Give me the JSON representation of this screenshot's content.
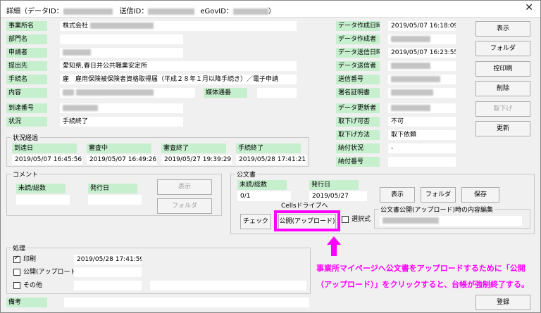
{
  "window": {
    "title_prefix": "詳細（データID：",
    "title_send": "　送信ID：",
    "title_egov": "eGovID：",
    "title_suffix": "）",
    "close_glyph": "✕"
  },
  "labels": {
    "office": "事業所名",
    "dept": "部門名",
    "applicant": "申請者",
    "destination": "提出先",
    "procedure": "手続名",
    "content": "内容",
    "medium": "媒体通番",
    "arrival_no": "到達番号",
    "status": "状況",
    "created_at": "データ作成日時",
    "creator": "データ作成者",
    "sent_at": "データ送信日時",
    "sender": "データ送信者",
    "send_no": "送信番号",
    "signer_cert": "署名証明書",
    "updater": "データ更新者",
    "withdraw_ok": "取下げ可否",
    "withdraw_method": "取下げ方法",
    "payment_status": "納付状況",
    "payment_no": "納付番号"
  },
  "values": {
    "office": "株式会社",
    "destination": "愛知県,春日井公共職業安定所",
    "procedure": "雇　雇用保険被保険者資格取得届（平成２８年１月以降手続き）／電子申請",
    "status": "手続終了",
    "created_at": "2019/05/07 16:18:09",
    "sent_at": "2019/05/07 16:23:55",
    "withdraw_ok": "不可",
    "withdraw_method": "取下依頼",
    "payment_status": "-"
  },
  "progress": {
    "title": "状況経過",
    "steps": [
      {
        "label": "到達日",
        "value": "2019/05/07 16:45:56"
      },
      {
        "label": "審査中",
        "value": "2019/05/07 16:49:26"
      },
      {
        "label": "審査終了",
        "value": "2019/05/27 19:39:29"
      },
      {
        "label": "手続終了",
        "value": "2019/05/28 17:41:21"
      }
    ]
  },
  "comment": {
    "title": "コメント",
    "unread_label": "未読/総数",
    "issue_label": "発行日",
    "show_button": "表示",
    "folder_button": "フォルダ"
  },
  "docs": {
    "title": "公文書",
    "unread_label": "未読/総数",
    "unread_value": "0/1",
    "issue_label": "発行日",
    "issue_value": "2019/05/27",
    "show_button": "表示",
    "folder_button": "フォルダ",
    "save_button": "保存",
    "cells_label": "Cellsドライブへ",
    "check_button": "チェック",
    "publish_button": "公開(アップロード)",
    "select_label": "選択式",
    "publish_edit_title": "公文書公開(アップロード)時の内容編集"
  },
  "process": {
    "title": "処理",
    "print_label": "印刷",
    "print_value": "2019/05/28 17:41:59",
    "publish_label": "公開(アップロード)",
    "other_label": "その他"
  },
  "remarks": {
    "label": "備考"
  },
  "side_buttons": {
    "show": "表示",
    "folder": "フォルダ",
    "copy_print": "控印刷",
    "delete": "削除",
    "withdraw": "取下げ",
    "update": "更新",
    "register": "登録"
  },
  "annotation": {
    "line1": "事業所マイページへ公文書をアップロードするために「公開",
    "line2": "（アップロード）」をクリックすると、台帳が強制終了する。"
  },
  "colors": {
    "label_bg": "#c6efce",
    "highlight": "#ff00ff"
  }
}
